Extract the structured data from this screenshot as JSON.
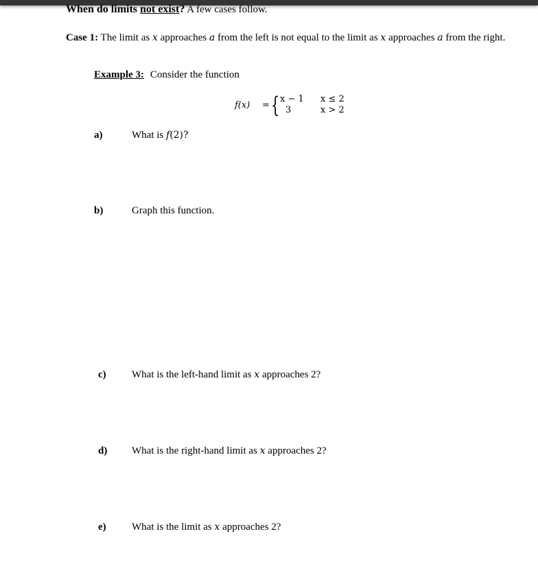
{
  "header": {
    "title_part1": "When do limits ",
    "title_underlined": "not exist",
    "title_part2": "?",
    "title_rest": " A few cases follow."
  },
  "case1": {
    "label": "Case 1:",
    "text_1": " The limit as ",
    "var_x": "x",
    "text_2": " approaches ",
    "var_a": "a",
    "text_3": " from the left is not equal to the limit as ",
    "text_4": " approaches ",
    "text_5": " from the right."
  },
  "example": {
    "label": "Example 3:",
    "text": "Consider the function"
  },
  "function": {
    "name": "f(x)",
    "equals": "=",
    "brace": "{",
    "case1_expr": "x − 1",
    "case1_cond": "x ≤ 2",
    "case2_expr": "3",
    "case2_cond": "x > 2"
  },
  "questions": [
    {
      "letter": "a)",
      "text_pre": "What is ",
      "math": "f",
      "text_post": "(2)?"
    },
    {
      "letter": "b)",
      "text": "Graph this function."
    },
    {
      "letter": "c)",
      "text_pre": "What is the left-hand limit as ",
      "math": "x",
      "text_post": " approaches 2?"
    },
    {
      "letter": "d)",
      "text_pre": "What is the right-hand limit as ",
      "math": "x",
      "text_post": " approaches 2?"
    },
    {
      "letter": "e)",
      "text_pre": "What is the limit as ",
      "math": "x",
      "text_post": " approaches 2?"
    }
  ]
}
